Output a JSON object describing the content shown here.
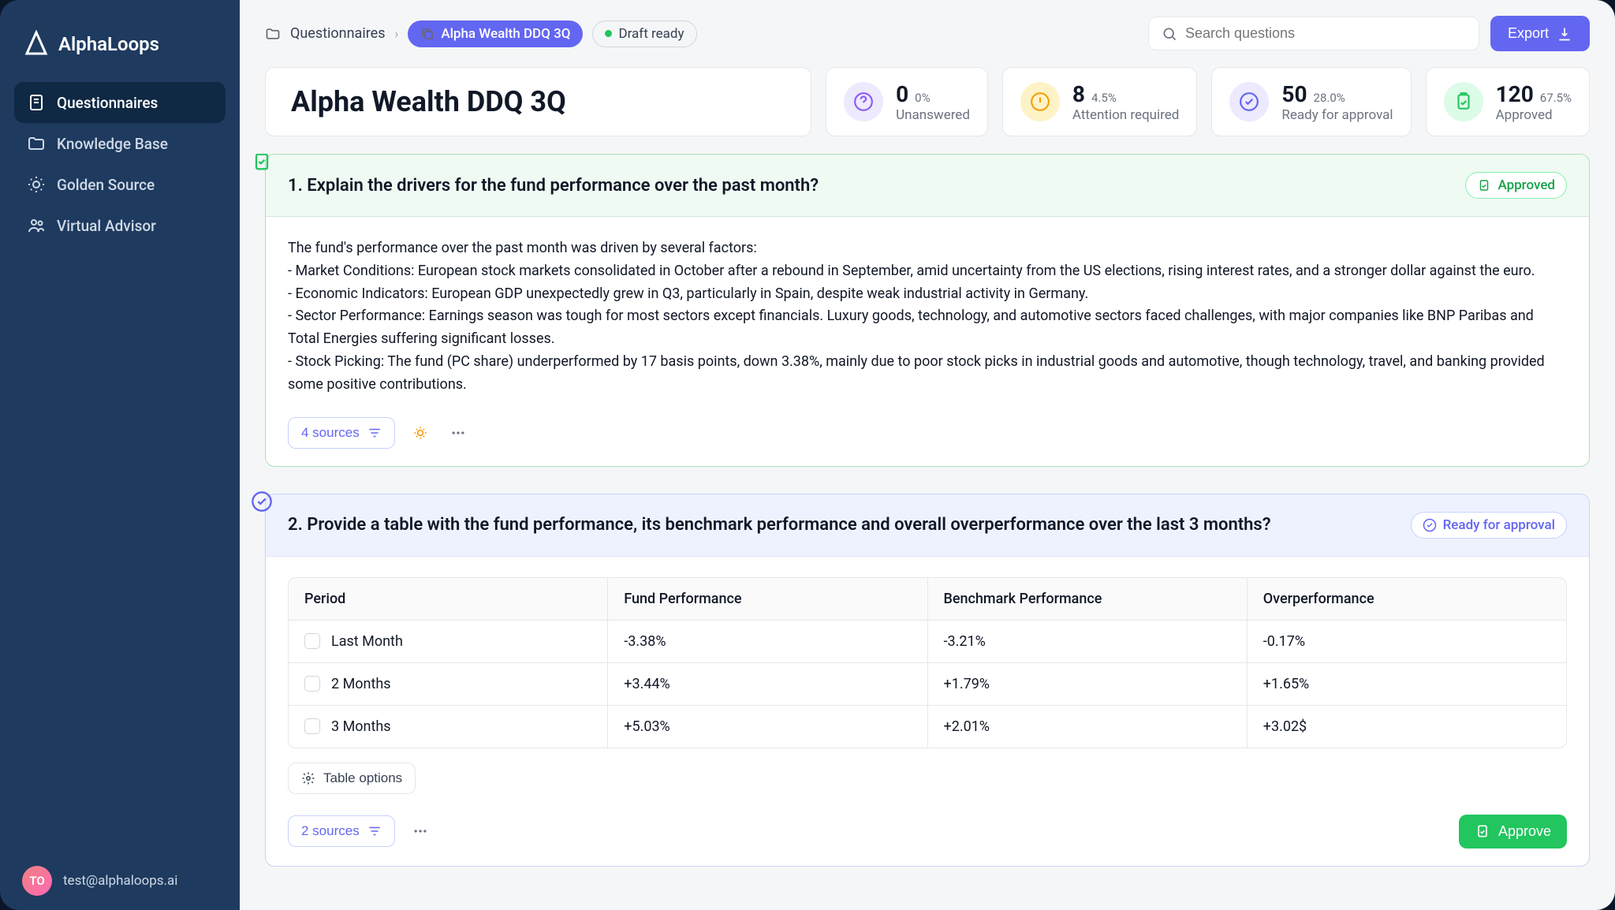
{
  "brand": "AlphaLoops",
  "nav": {
    "items": [
      "Questionnaires",
      "Knowledge Base",
      "Golden Source",
      "Virtual Advisor"
    ]
  },
  "user": {
    "initials": "TO",
    "email": "test@alphaloops.ai"
  },
  "crumb_root": "Questionnaires",
  "crumb_current": "Alpha Wealth DDQ 3Q",
  "status": "Draft ready",
  "search_ph": "Search questions",
  "export": "Export",
  "title": "Alpha Wealth DDQ 3Q",
  "stats": [
    {
      "n": "0",
      "p": "0%",
      "l": "Unanswered"
    },
    {
      "n": "8",
      "p": "4.5%",
      "l": "Attention required"
    },
    {
      "n": "50",
      "p": "28.0%",
      "l": "Ready for approval"
    },
    {
      "n": "120",
      "p": "67.5%",
      "l": "Approved"
    }
  ],
  "q1": {
    "title": "1. Explain the drivers for the fund performance over the past month?",
    "badge": "Approved",
    "body": "The fund's performance over the past month was driven by several factors:\n- Market Conditions: European stock markets consolidated in October after a rebound in September, amid uncertainty from the US elections, rising interest rates, and a stronger dollar against the euro.\n- Economic Indicators: European GDP unexpectedly grew in Q3, particularly in Spain, despite weak industrial activity in Germany.\n- Sector Performance: Earnings season was tough for most sectors except financials. Luxury goods, technology, and automotive sectors faced challenges, with major companies like BNP Paribas and Total Energies suffering significant losses.\n- Stock Picking: The fund (PC share) underperformed by 17 basis points, down 3.38%, mainly due to poor stock picks in industrial goods and automotive, though technology, travel, and banking provided some positive contributions.",
    "sources": "4 sources"
  },
  "q2": {
    "title": "2. Provide a table with the fund performance, its benchmark performance and overall overperformance over the last 3 months?",
    "badge": "Ready for approval",
    "headers": [
      "Period",
      "Fund Performance",
      "Benchmark Performance",
      "Overperformance"
    ],
    "rows": [
      [
        "Last Month",
        "-3.38%",
        "-3.21%",
        "-0.17%"
      ],
      [
        "2 Months",
        "+3.44%",
        "+1.79%",
        "+1.65%"
      ],
      [
        "3 Months",
        "+5.03%",
        "+2.01%",
        "+3.02$"
      ]
    ],
    "tblopt": "Table options",
    "sources": "2 sources",
    "approve": "Approve"
  }
}
